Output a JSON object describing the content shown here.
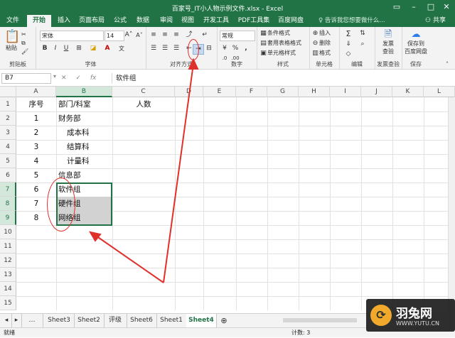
{
  "window": {
    "title": "百家号_IT小人物示例文件.xlsx - Excel",
    "controls": [
      "restore-icon",
      "minimize-icon",
      "maximize-icon",
      "close-icon"
    ]
  },
  "ribbon_tabs": [
    "文件",
    "开始",
    "插入",
    "页面布局",
    "公式",
    "数据",
    "审阅",
    "视图",
    "开发工具",
    "PDF工具集",
    "百度网盘"
  ],
  "active_tab": "开始",
  "tell_me": "♀ 告诉我您想要做什么...",
  "share": "共享",
  "clipboard": {
    "paste": "粘贴",
    "label": "剪贴板"
  },
  "font": {
    "name": "宋体",
    "size": "14",
    "label": "字体",
    "bold": "B",
    "italic": "I",
    "underline": "U",
    "grow": "A",
    "shrink": "A"
  },
  "alignment": {
    "label": "对齐方式"
  },
  "number": {
    "format": "常规",
    "label": "数字",
    "percent": "%",
    "comma": ","
  },
  "styles": {
    "cond": "条件格式",
    "table": "套用表格格式",
    "cell": "单元格样式",
    "label": "样式"
  },
  "cells": {
    "insert": "插入",
    "delete": "删除",
    "format": "格式",
    "label": "单元格"
  },
  "editing": {
    "label": "编辑"
  },
  "invoice": {
    "btn1": "发票",
    "btn2": "查验",
    "label": "发票查验"
  },
  "save": {
    "btn1": "保存到",
    "btn2": "百度网盘",
    "label": "保存"
  },
  "formula_bar": {
    "name_box": "B7",
    "cancel": "✕",
    "enter": "✓",
    "fx": "fx",
    "content": "软件组"
  },
  "columns": [
    "A",
    "B",
    "C",
    "D",
    "E",
    "F",
    "G",
    "H",
    "I",
    "J",
    "K",
    "L"
  ],
  "rows": [
    "1",
    "2",
    "3",
    "4",
    "5",
    "6",
    "7",
    "8",
    "9",
    "10",
    "11",
    "12",
    "13",
    "14",
    "15"
  ],
  "table": {
    "header": [
      "序号",
      "部门/科室",
      "人数"
    ],
    "rows": [
      {
        "num": "1",
        "dept": "财务部"
      },
      {
        "num": "2",
        "dept": "成本科"
      },
      {
        "num": "3",
        "dept": "结算科"
      },
      {
        "num": "4",
        "dept": "计量科"
      },
      {
        "num": "5",
        "dept": "信息部"
      },
      {
        "num": "6",
        "dept": "软件组"
      },
      {
        "num": "7",
        "dept": "硬件组"
      },
      {
        "num": "8",
        "dept": "网络组"
      }
    ]
  },
  "sheets": [
    "Sheet3",
    "Sheet2",
    "评级",
    "Sheet6",
    "Sheet1",
    "Sheet4"
  ],
  "active_sheet": "Sheet4",
  "status": {
    "ready": "就绪",
    "count": "计数: 3"
  },
  "watermark": {
    "brand": "羽兔网",
    "url": "WWW.YUTU.CN"
  },
  "colors": {
    "excel_green": "#217346",
    "annotation_red": "#e0302a",
    "selection_gray": "#d2d2d2"
  }
}
